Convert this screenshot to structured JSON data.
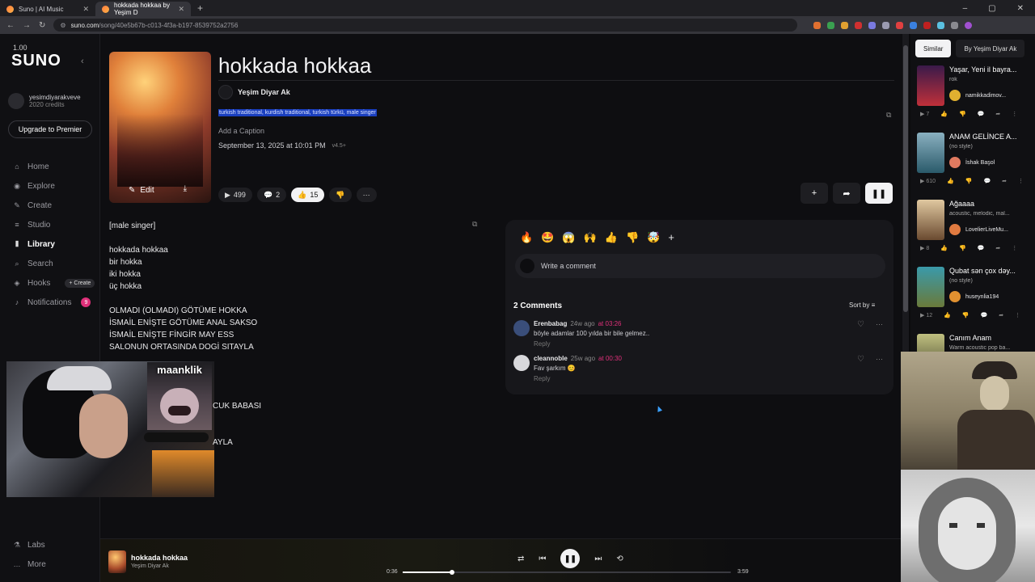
{
  "browser": {
    "tabs": [
      {
        "title": "Suno | AI Music"
      },
      {
        "title": "hokkada hokkaa by Yeşim D"
      }
    ],
    "url_host": "suno.com",
    "url_path": "/song/40e5b67b-c013-4f3a-b197-8539752a2756"
  },
  "sidebar": {
    "version": "1.00",
    "logo": "SUNO",
    "user_name": "yesimdiyarakveve",
    "credits": "2020 credits",
    "upgrade": "Upgrade to Premier",
    "nav": [
      {
        "label": "Home",
        "icon": "home-icon"
      },
      {
        "label": "Explore",
        "icon": "compass-icon"
      },
      {
        "label": "Create",
        "icon": "create-icon"
      },
      {
        "label": "Studio",
        "icon": "studio-icon"
      },
      {
        "label": "Library",
        "icon": "library-icon"
      },
      {
        "label": "Search",
        "icon": "search-icon"
      },
      {
        "label": "Hooks",
        "icon": "hooks-icon"
      },
      {
        "label": "Notifications",
        "icon": "bell-icon"
      }
    ],
    "hooks_create": "+ Create",
    "notif_count": "9",
    "bottom": [
      {
        "label": "Labs"
      },
      {
        "label": "More"
      }
    ]
  },
  "song": {
    "title": "hokkada hokkaa",
    "artist": "Yeşim Diyar Ak",
    "tags": "turkish traditional, kurdish traditional, turkish türkü, male singer",
    "caption_placeholder": "Add a Caption",
    "date": "September 13, 2025 at 10:01 PM",
    "model": "v4.5+",
    "edit_label": "Edit",
    "plays": "499",
    "comments": "2",
    "likes": "15"
  },
  "lyrics": {
    "lines": [
      "[male singer]",
      "",
      "hokkada hokkaa",
      "bir hokka",
      "iki hokka",
      "üç hokka",
      "",
      "OLMADI (OLMADI) GÖTÜME HOKKA",
      "İSMAİL ENİŞTE GÖTÜME ANAL SAKSO",
      "İSMAİL ENİŞTE FİNGİR MAY ESS",
      "SALONUN ORTASINDA DOGİ SITAYLA"
    ],
    "frag1": "CUK BABASI",
    "frag2": "AYLA"
  },
  "comments_panel": {
    "emojis": [
      "🔥",
      "🤩",
      "😱",
      "🙌",
      "👍",
      "👎",
      "🤯"
    ],
    "placeholder": "Write a comment",
    "count_label": "2 Comments",
    "sort_label": "Sort by",
    "items": [
      {
        "user": "Erenbabag",
        "ago": "24w ago",
        "at": "at 03:26",
        "text": "böyle adamlar 100 yılda bir bile gelmez..",
        "reply": "Reply"
      },
      {
        "user": "cleannoble",
        "ago": "25w ago",
        "at": "at 00:30",
        "text": "Fav şarkım 😊",
        "reply": "Reply"
      }
    ]
  },
  "right_panel": {
    "tabs": [
      "Similar",
      "By Yeşim Diyar Ak"
    ],
    "songs": [
      {
        "title": "Yaşar, Yeni il bayra...",
        "style": "rok",
        "artist": "namikkadimov...",
        "plays": "7",
        "color": "#c0303a"
      },
      {
        "title": "ANAM GELİNCE A...",
        "style": "(no style)",
        "artist": "İshak Başol",
        "plays": "610",
        "color": "#4a8aa0"
      },
      {
        "title": "Ağaaaa",
        "style": "acoustic, melodic, mal...",
        "artist": "LovelierLiveMu...",
        "plays": "8",
        "color": "#a07a50"
      },
      {
        "title": "Qubat sən çox dəy...",
        "style": "(no style)",
        "artist": "huseynlia194",
        "plays": "12",
        "color": "#3a7a8a"
      },
      {
        "title": "Canım Anam",
        "style": "Warm acoustic pop ba...",
        "artist": "",
        "plays": "",
        "color": "#8a8a50"
      }
    ]
  },
  "player": {
    "title": "hokkada hokkaa",
    "artist": "Yeşim Diyar Ak",
    "current": "0:36",
    "total": "3:59",
    "progress": 0.15
  },
  "overlay": {
    "label": "maanklik"
  }
}
